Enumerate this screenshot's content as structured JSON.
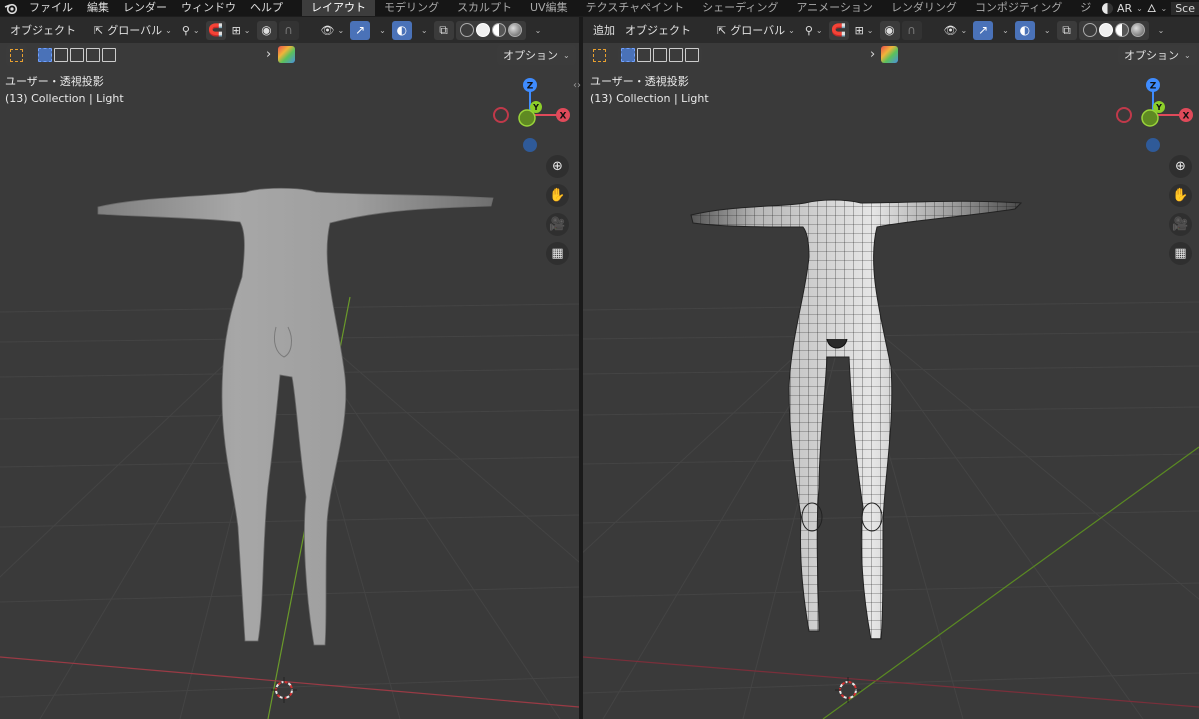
{
  "topbar": {
    "menus": [
      "ファイル",
      "編集",
      "レンダー",
      "ウィンドウ",
      "ヘルプ"
    ],
    "workspaces": [
      "レイアウト",
      "モデリング",
      "スカルプト",
      "UV編集",
      "テクスチャペイント",
      "シェーディング",
      "アニメーション",
      "レンダリング",
      "コンポジティング",
      "ジ"
    ],
    "active_workspace": 0,
    "ar_label": "AR",
    "scene_label": "Sce"
  },
  "left_viewport": {
    "mode_items": [
      "オブジェクト"
    ],
    "transform_orientation": "グローバル",
    "options_label": "オプション",
    "view_name": "ユーザー・透視投影",
    "collection_info": "(13) Collection | Light",
    "gizmo": {
      "z": "Z",
      "y": "Y",
      "x": "X"
    }
  },
  "right_viewport": {
    "mode_items": [
      "追加",
      "オブジェクト"
    ],
    "transform_orientation": "グローバル",
    "options_label": "オプション",
    "view_name": "ユーザー・透視投影",
    "collection_info": "(13) Collection | Light",
    "gizmo": {
      "z": "Z",
      "y": "Y",
      "x": "X"
    }
  },
  "icons": {
    "nav": [
      "zoom-icon",
      "hand-icon",
      "camera-icon",
      "grid-icon"
    ]
  },
  "colors": {
    "viewport_bg": "#3a3a3a",
    "header_bg": "#2b2b2b",
    "axis_x": "#e04a5a",
    "axis_y": "#8ccf2a",
    "axis_z": "#3f8cff",
    "mesh": "#9c9c9c",
    "active_blue": "#4a72b8"
  }
}
